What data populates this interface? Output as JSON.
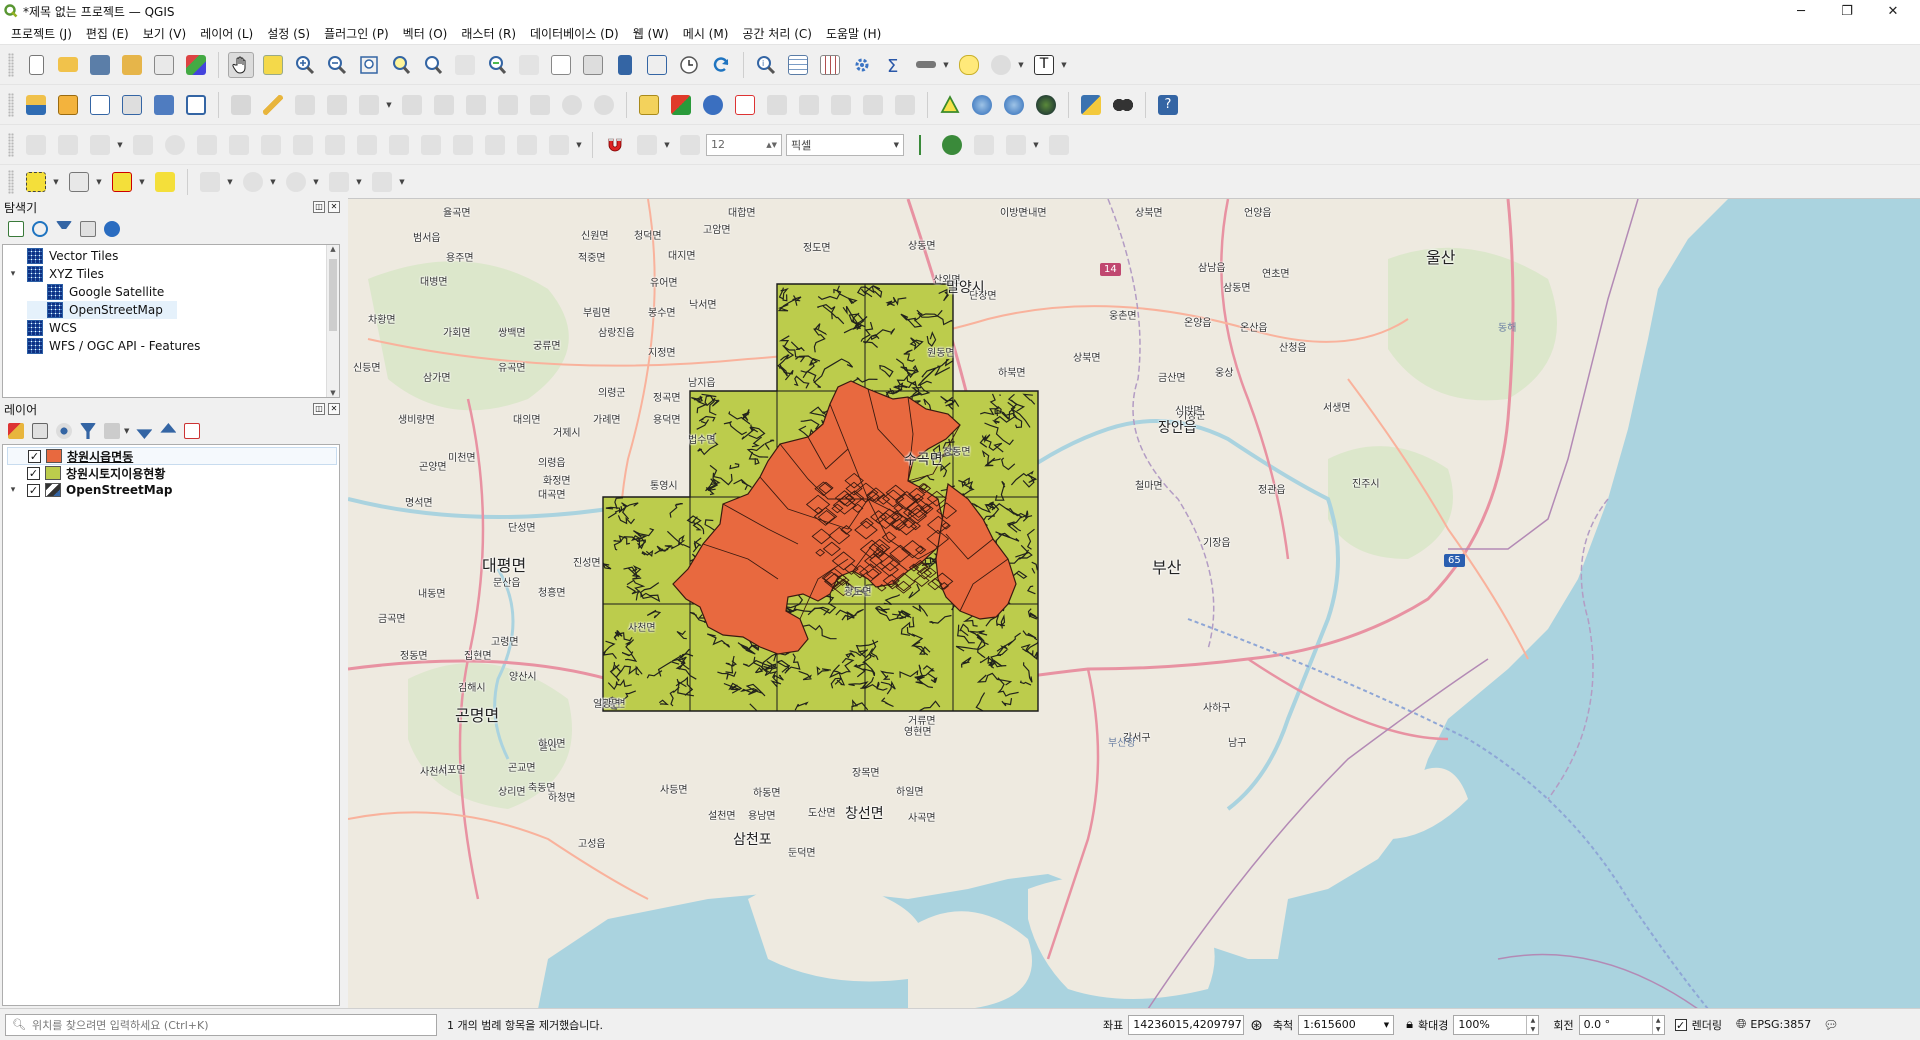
{
  "window": {
    "title": "*제목 없는 프로젝트 — QGIS",
    "controls": [
      "─",
      "❐",
      "✕"
    ]
  },
  "menubar": [
    "프로젝트 (J)",
    "편집 (E)",
    "보기 (V)",
    "레이어 (L)",
    "설정 (S)",
    "플러그인 (P)",
    "벡터 (O)",
    "래스터 (R)",
    "데이터베이스 (D)",
    "웹 (W)",
    "메시 (M)",
    "공간 처리 (C)",
    "도움말 (H)"
  ],
  "digitizing_toolbar": {
    "snap_tolerance": "12",
    "snap_units": "픽셀"
  },
  "browser_panel": {
    "title": "탐색기",
    "items": [
      {
        "label": "Vector Tiles",
        "icon": "vector-tiles-icon",
        "expander": "",
        "indent": 0
      },
      {
        "label": "XYZ Tiles",
        "icon": "xyz-tiles-icon",
        "expander": "▾",
        "indent": 0
      },
      {
        "label": "Google Satellite",
        "icon": "xyz-tile-layer-icon",
        "expander": "",
        "indent": 1
      },
      {
        "label": "OpenStreetMap",
        "icon": "xyz-tile-layer-icon",
        "expander": "",
        "indent": 1
      },
      {
        "label": "WCS",
        "icon": "globe-icon",
        "expander": "",
        "indent": 0
      },
      {
        "label": "WFS / OGC API - Features",
        "icon": "wfs-icon",
        "expander": "",
        "indent": 0
      }
    ]
  },
  "layers_panel": {
    "title": "레이어",
    "layers": [
      {
        "name": "창원시읍면동",
        "checked": "✓",
        "swatch": "#e8693f",
        "expander": ""
      },
      {
        "name": "창원시토지이용현황",
        "checked": "✓",
        "swatch": "#bccc4c",
        "expander": ""
      },
      {
        "name": "OpenStreetMap",
        "checked": "✓",
        "swatch": "",
        "expander": "▾"
      }
    ]
  },
  "map_labels": {
    "places": [
      "율곡면",
      "대합면",
      "고암면",
      "산내면",
      "상북면",
      "언양읍",
      "범서읍",
      "신원면",
      "청덕면",
      "이방면",
      "울산",
      "용주면",
      "적중면",
      "대지면",
      "정도면",
      "상동면",
      "대병면",
      "유어면",
      "밀양시",
      "산외면",
      "단장면",
      "삼남읍",
      "삼동면",
      "부림면",
      "봉수면",
      "낙서면",
      "차황면",
      "가회면",
      "쌍백면",
      "궁류면",
      "삼랑진읍",
      "원동면",
      "하북면",
      "웅촌면",
      "온양읍",
      "온산읍",
      "산청읍",
      "신등면",
      "삼가면",
      "유곡면",
      "지정면",
      "남지읍",
      "상북면",
      "울산",
      "의령군",
      "정곡면",
      "웅상",
      "서생면",
      "생비량면",
      "대의면",
      "가례면",
      "용덕면",
      "신반면",
      "양산시",
      "장안읍",
      "미천면",
      "의령읍",
      "법수면",
      "상동면",
      "기장군",
      "철마면",
      "단성면",
      "화정면",
      "명석면",
      "집현면",
      "대곡면",
      "대동면",
      "일광면",
      "정관읍",
      "기장읍",
      "금산면",
      "김해시",
      "진주시",
      "수곡면",
      "대평면",
      "진성면",
      "부산",
      "내동면",
      "문산읍",
      "청흥면",
      "금곡면",
      "고령면",
      "사천면",
      "곤양면",
      "정동면",
      "곤명면",
      "사천시",
      "서포면",
      "영현면",
      "곤교면",
      "축동면",
      "고성읍",
      "거류면",
      "강서구",
      "사하구",
      "남구",
      "하이면",
      "상리면",
      "하청면",
      "장목면",
      "하일면",
      "사곡면",
      "연초면",
      "용남면",
      "둔덕면",
      "거제시",
      "통영시",
      "도산면",
      "광도면",
      "사등면",
      "설천면",
      "하동면",
      "창선면",
      "삼천포"
    ],
    "shields": [
      "14",
      "65"
    ],
    "water_labels": [
      "동해",
      "부산항"
    ]
  },
  "statusbar": {
    "search_placeholder": "위치를 찾으려면 입력하세요 (Ctrl+K)",
    "message": "1 개의 범례 항목을 제거했습니다.",
    "coord_label": "좌표",
    "coord_value": "14236015,4209797",
    "scale_label": "축척",
    "scale_value": "1:615600",
    "magnifier_label": "확대경",
    "magnifier_value": "100%",
    "rotation_label": "회전",
    "rotation_value": "0.0 °",
    "render_label": "렌더링",
    "crs": "EPSG:3857"
  },
  "colors": {
    "eup_myeon_dong_fill": "#e8693f",
    "land_use_fill": "#bccc4c",
    "sea": "#aad3df",
    "land": "#eeeae0",
    "motorway": "#e892a2",
    "trunk": "#f9b29c"
  }
}
